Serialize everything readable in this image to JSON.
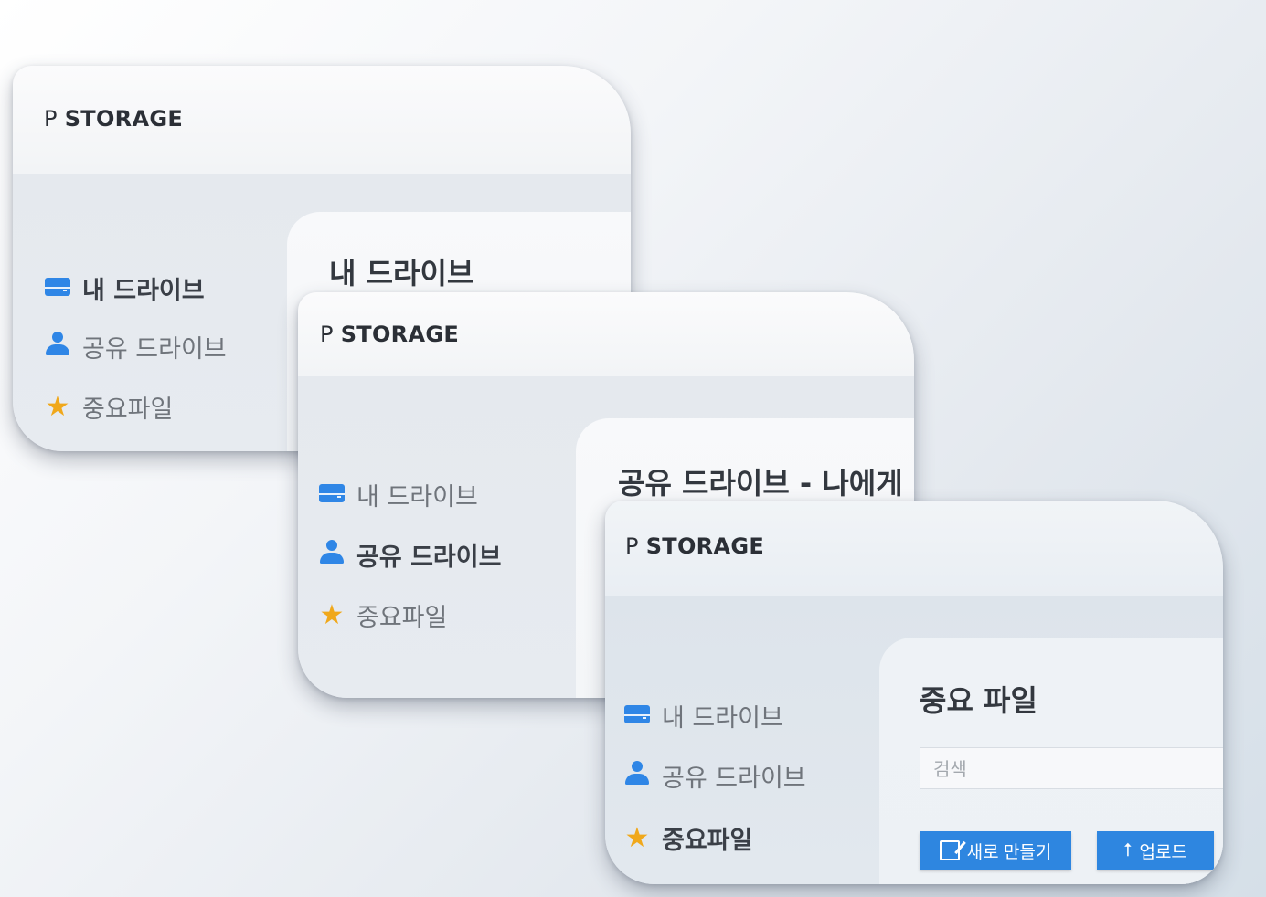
{
  "brand": {
    "prefix": "P",
    "name": "STORAGE"
  },
  "nav": {
    "my_drive": "내 드라이브",
    "shared_drive": "공유 드라이브",
    "important": "중요파일"
  },
  "screens": [
    {
      "panel_title": "내 드라이브",
      "active_nav": "my_drive"
    },
    {
      "panel_title": "공유 드라이브 - 나에게",
      "active_nav": "shared_drive"
    },
    {
      "panel_title": "중요 파일",
      "active_nav": "important",
      "search_placeholder": "검색",
      "new_button": "새로 만들기",
      "upload_button": "업로드"
    }
  ],
  "colors": {
    "accent": "#2e86e0",
    "star": "#f0a81b"
  }
}
